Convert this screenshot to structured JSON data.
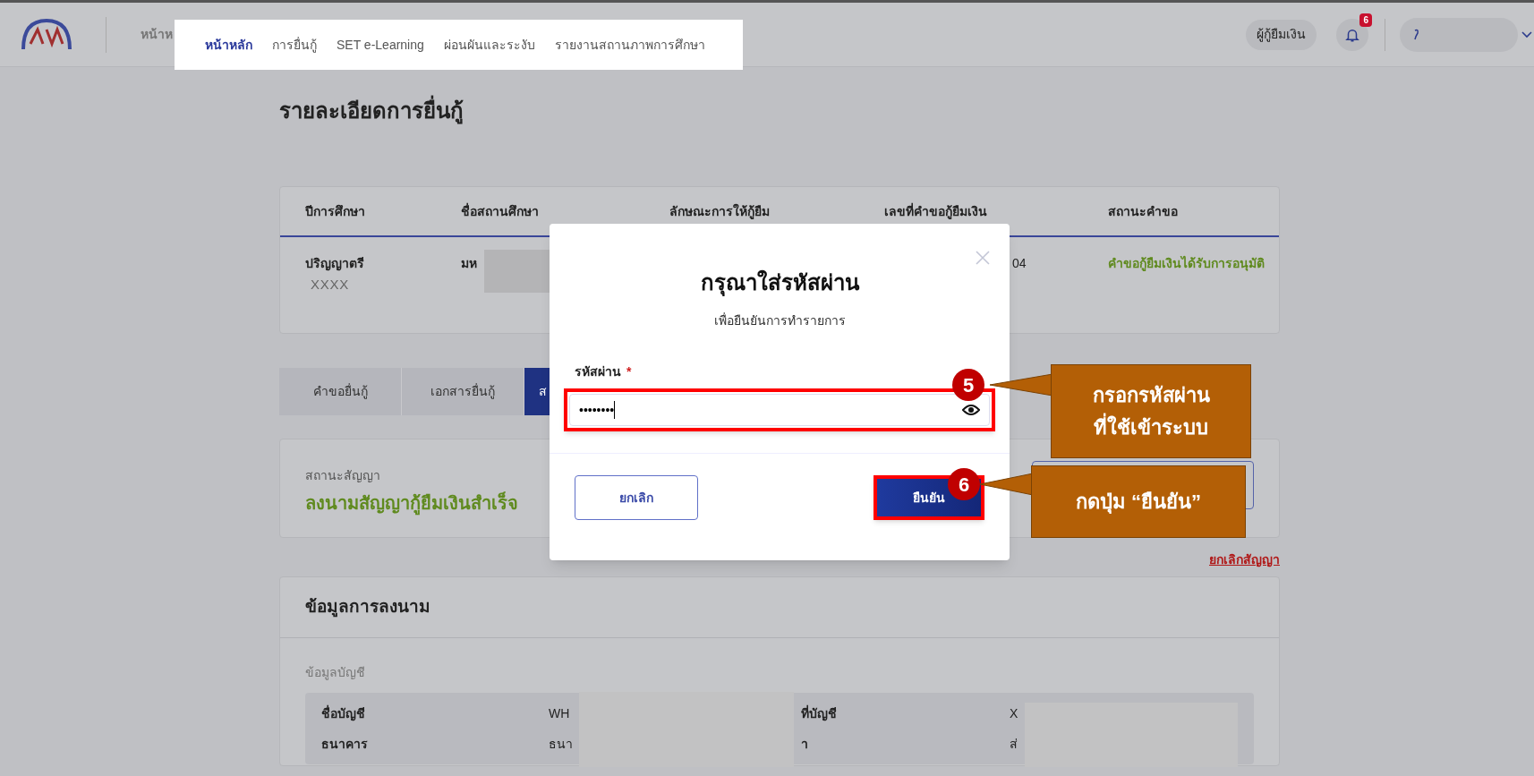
{
  "header": {
    "partial_nav_text": "หน้าห",
    "nav": [
      {
        "label": "หน้าหลัก",
        "selected": true
      },
      {
        "label": "การยื่นกู้",
        "selected": false
      },
      {
        "label": "SET e-Learning",
        "selected": false
      },
      {
        "label": "ผ่อนผันและระงับ",
        "selected": false
      },
      {
        "label": "รายงานสถานภาพการศึกษา",
        "selected": false
      }
    ],
    "role_button": "ผู้กู้ยืมเงิน",
    "notification_count": "6"
  },
  "page_title": "รายละเอียดการยื่นกู้",
  "request_table": {
    "columns": [
      "ปีการศึกษา",
      "ชื่อสถานศึกษา",
      "ลักษณะการให้กู้ยืม",
      "เลขที่คำขอกู้ยืมเงิน",
      "สถานะคำขอ"
    ],
    "rows": [
      {
        "cells": [
          {
            "kind": "text",
            "text": "ปริญญาตรี",
            "subtext": "XXXX"
          },
          {
            "kind": "text",
            "text": "มห"
          },
          {
            "kind": "empty"
          },
          {
            "kind": "text",
            "text": "04"
          },
          {
            "kind": "status",
            "text": "คำขอกู้ยืมเงินได้รับการอนุมัติ"
          }
        ]
      }
    ]
  },
  "tabs": [
    {
      "label": "คำขอยื่นกู้",
      "selected": false
    },
    {
      "label": "เอกสารยื่นกู้",
      "selected": false
    },
    {
      "label": "ส",
      "selected": true
    }
  ],
  "contract_status": {
    "label": "สถานะสัญญา",
    "value": "ลงนามสัญญากู้ยืมเงินสำเร็จ"
  },
  "cancel_contract_link": "ยกเลิกสัญญา",
  "signing_info": {
    "title": "ข้อมูลการลงนาม",
    "section": "ข้อมูลบัญชี",
    "rows": [
      {
        "label": "ชื่อบัญชี",
        "value": "WH",
        "label_2": "ที่บัญชี",
        "value_2": "X"
      },
      {
        "label": "ธนาคาร",
        "value": "ธนา",
        "label_2": "า",
        "value_2": "ส่"
      }
    ]
  },
  "password_dialog": {
    "title": "กรุณาใส่รหัสผ่าน",
    "subtitle": "เพื่อยืนยันการทำรายการ",
    "field_label": "รหัสผ่าน",
    "required_mark": "*",
    "value": "••••••••",
    "cancel_button": "ยกเลิก",
    "confirm_button": "ยืนยัน"
  },
  "annotations": [
    {
      "number": "5",
      "text": "กรอกรหัสผ่าน\nที่ใช้เข้าระบบ"
    },
    {
      "number": "6",
      "text": "กดปุ่ม “ยืนยัน”"
    }
  ]
}
